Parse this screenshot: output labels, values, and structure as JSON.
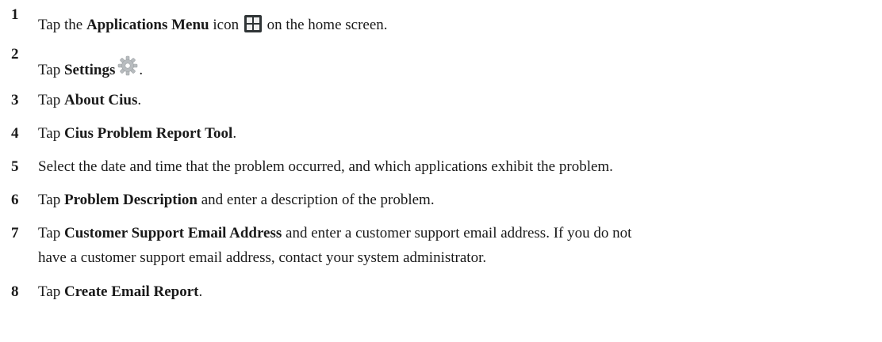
{
  "steps": [
    {
      "number": "1",
      "before": "Tap the ",
      "bold": "Applications Menu",
      "after_bold": " icon ",
      "icon": "applications-menu-grid-icon",
      "after_icon": " on the home screen."
    },
    {
      "number": "2",
      "before": "Tap ",
      "bold": "Settings",
      "icon": "settings-gear-icon",
      "after_icon": "."
    },
    {
      "number": "3",
      "before": "Tap ",
      "bold": "About Cius",
      "after": "."
    },
    {
      "number": "4",
      "before": "Tap ",
      "bold": "Cius Problem Report Tool",
      "after": "."
    },
    {
      "number": "5",
      "text": "Select the date and time that the problem occurred, and which applications exhibit the problem."
    },
    {
      "number": "6",
      "before": "Tap ",
      "bold": "Problem Description",
      "after": " and enter a description of the problem."
    },
    {
      "number": "7",
      "before": "Tap ",
      "bold": "Customer Support Email Address",
      "after_line1": " and enter a customer support email address. If you do not",
      "line2": "have a customer support email address, contact your system administrator."
    },
    {
      "number": "8",
      "before": "Tap ",
      "bold": "Create Email Report",
      "after": "."
    }
  ],
  "colors": {
    "text": "#1a1a1a",
    "icon_dark": "#2f3436",
    "icon_light": "#f0f0f0",
    "gear": "#b8bcbf"
  }
}
